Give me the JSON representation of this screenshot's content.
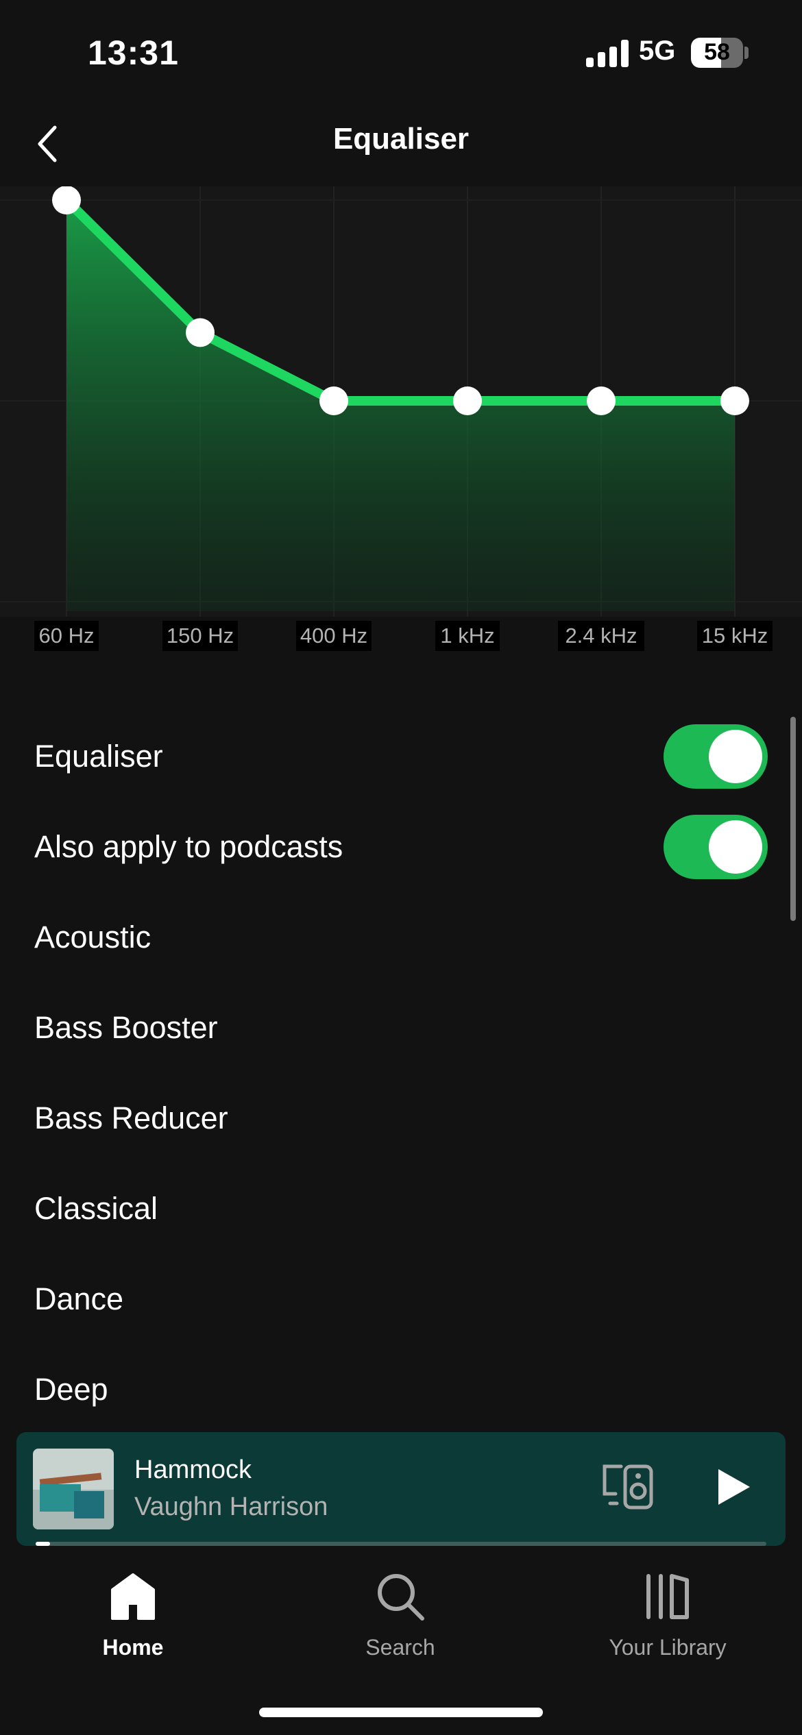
{
  "status_bar": {
    "time": "13:31",
    "network": "5G",
    "battery_level": "58",
    "battery_fraction": 0.58,
    "signal_bars": 4
  },
  "header": {
    "title": "Equaliser",
    "back_icon": "chevron-left-icon"
  },
  "equalizer": {
    "band_labels": [
      "60 Hz",
      "150 Hz",
      "400 Hz",
      "1 kHz",
      "2.4 kHz",
      "15 kHz"
    ],
    "band_levels": [
      1.0,
      0.67,
      0.5,
      0.5,
      0.5,
      0.5
    ],
    "accent_color": "#1ed760"
  },
  "settings": {
    "equaliser_label": "Equaliser",
    "equaliser_enabled": true,
    "podcasts_label": "Also apply to podcasts",
    "podcasts_enabled": true,
    "presets": [
      "Acoustic",
      "Bass Booster",
      "Bass Reducer",
      "Classical",
      "Dance",
      "Deep"
    ]
  },
  "now_playing": {
    "title": "Hammock",
    "artist": "Vaughn Harrison",
    "progress": 0.02,
    "devices_icon": "connect-devices-icon",
    "play_icon": "play-icon",
    "background_color": "#0c3a36"
  },
  "bottom_nav": {
    "items": [
      {
        "label": "Home",
        "icon": "home-icon",
        "active": true
      },
      {
        "label": "Search",
        "icon": "search-icon",
        "active": false
      },
      {
        "label": "Your Library",
        "icon": "library-icon",
        "active": false
      }
    ]
  },
  "colors": {
    "background": "#121212",
    "toggle_on": "#1db954",
    "text_secondary": "#b3b3b3"
  }
}
